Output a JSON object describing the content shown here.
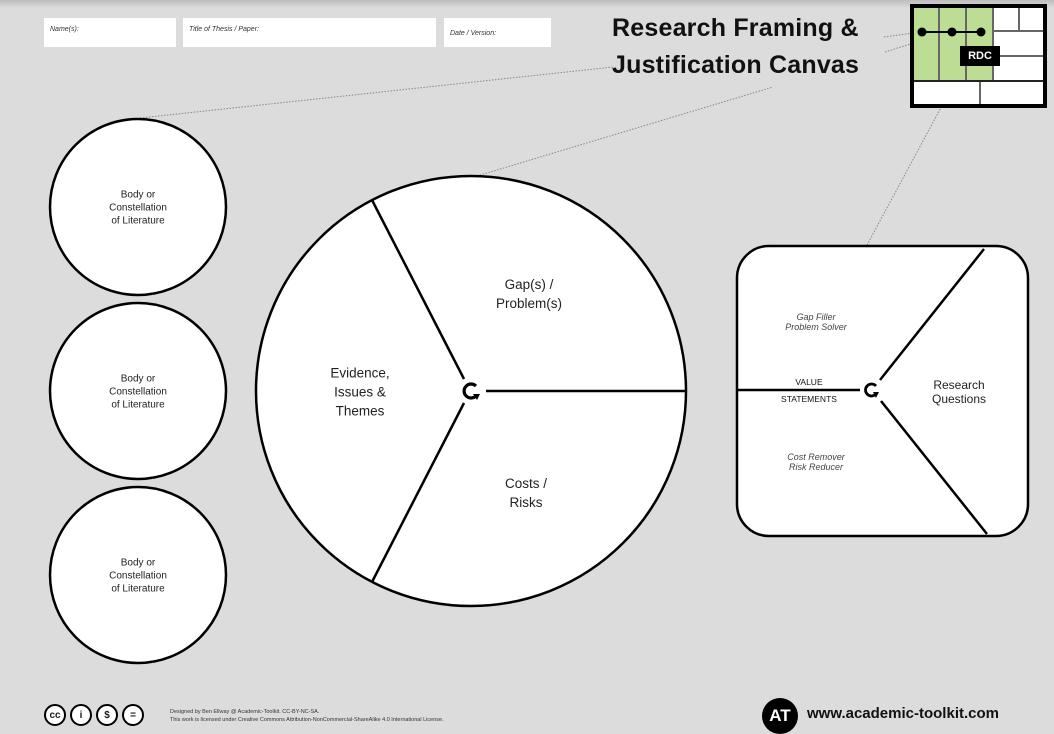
{
  "header": {
    "fields": {
      "names_label": "Name(s):",
      "title_label": "Title of Thesis / Paper:",
      "date_label": "Date / Version:"
    },
    "title_line1": "Research Framing &",
    "title_line2": "Justification Canvas",
    "badge": "RDC"
  },
  "literature": {
    "items": [
      {
        "line1": "Body or",
        "line2": "Constellation",
        "line3": "of Literature"
      },
      {
        "line1": "Body or",
        "line2": "Constellation",
        "line3": "of Literature"
      },
      {
        "line1": "Body or",
        "line2": "Constellation",
        "line3": "of Literature"
      }
    ]
  },
  "framing_wheel": {
    "segments": [
      {
        "line1": "Gap(s) /",
        "line2": "Problem(s)"
      },
      {
        "line1": "Evidence,",
        "line2": "Issues &",
        "line3": "Themes"
      },
      {
        "line1": "Costs /",
        "line2": "Risks"
      }
    ],
    "center_icon": "cycle-arrow-icon"
  },
  "value_panel": {
    "gap_filler": {
      "line1": "Gap Filler",
      "line2": "Problem Solver"
    },
    "value_label": "VALUE",
    "statements_label": "STATEMENTS",
    "cost_remover": {
      "line1": "Cost Remover",
      "line2": "Risk Reducer"
    },
    "research_questions": {
      "line1": "Research",
      "line2": "Questions"
    },
    "center_icon": "cycle-arrow-icon"
  },
  "mini_map": {
    "highlight_color": "#bedd94",
    "border_color": "#000000"
  },
  "footer": {
    "license_icons": [
      "cc-icon",
      "by-icon",
      "nc-icon",
      "sa-icon"
    ],
    "license_glyphs": [
      "cc",
      "i",
      "$",
      "="
    ],
    "credit_line1": "Designed by Ben Ellway @ Academic-Toolkit. CC-BY-NC-SA.",
    "credit_line2": "This work is licensed under Creative Commons Attribution-NonCommercial-ShareAlike 4.0 International License.",
    "logo_text": "AT",
    "website": "www.academic-toolkit.com"
  },
  "colors": {
    "background": "#dcdcdc",
    "panel": "#ffffff",
    "stroke": "#000000",
    "accent_green": "#bedd94"
  }
}
